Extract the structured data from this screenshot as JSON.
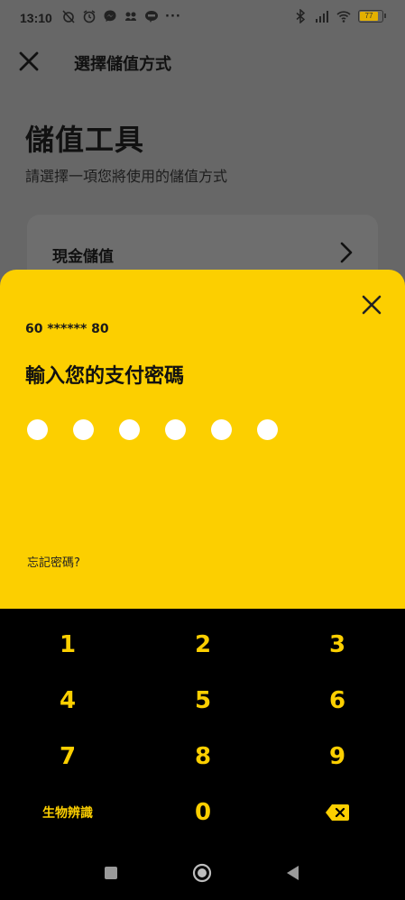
{
  "status_bar": {
    "time": "13:10",
    "overflow": "···",
    "battery_level": "77",
    "icons_left": [
      "alarm-off-icon",
      "alarm-icon",
      "messenger-icon",
      "app-icon",
      "line-icon"
    ],
    "icons_right": [
      "bluetooth-icon",
      "signal-icon",
      "wifi-icon",
      "battery-icon"
    ]
  },
  "header": {
    "title": "選擇儲值方式",
    "close_icon": "close-icon"
  },
  "main": {
    "title": "儲值工具",
    "subtitle": "請選擇一項您將使用的儲值方式",
    "options": [
      {
        "label": "現金儲值",
        "icon": "chevron-right-icon"
      }
    ]
  },
  "pin_sheet": {
    "account": "60 ****** 80",
    "title": "輸入您的支付密碼",
    "pin_length": 6,
    "forgot_link": "忘記密碼?",
    "colors": {
      "background": "#fccf00",
      "dot": "#ffffff"
    }
  },
  "keypad": {
    "keys": [
      "1",
      "2",
      "3",
      "4",
      "5",
      "6",
      "7",
      "8",
      "9"
    ],
    "biometric_label": "生物辨識",
    "zero": "0",
    "backspace_icon": "backspace-icon",
    "colors": {
      "background": "#000000",
      "key_text": "#fccf00"
    }
  },
  "nav_bar": {
    "buttons": [
      "recents-icon",
      "home-icon",
      "back-icon"
    ]
  }
}
